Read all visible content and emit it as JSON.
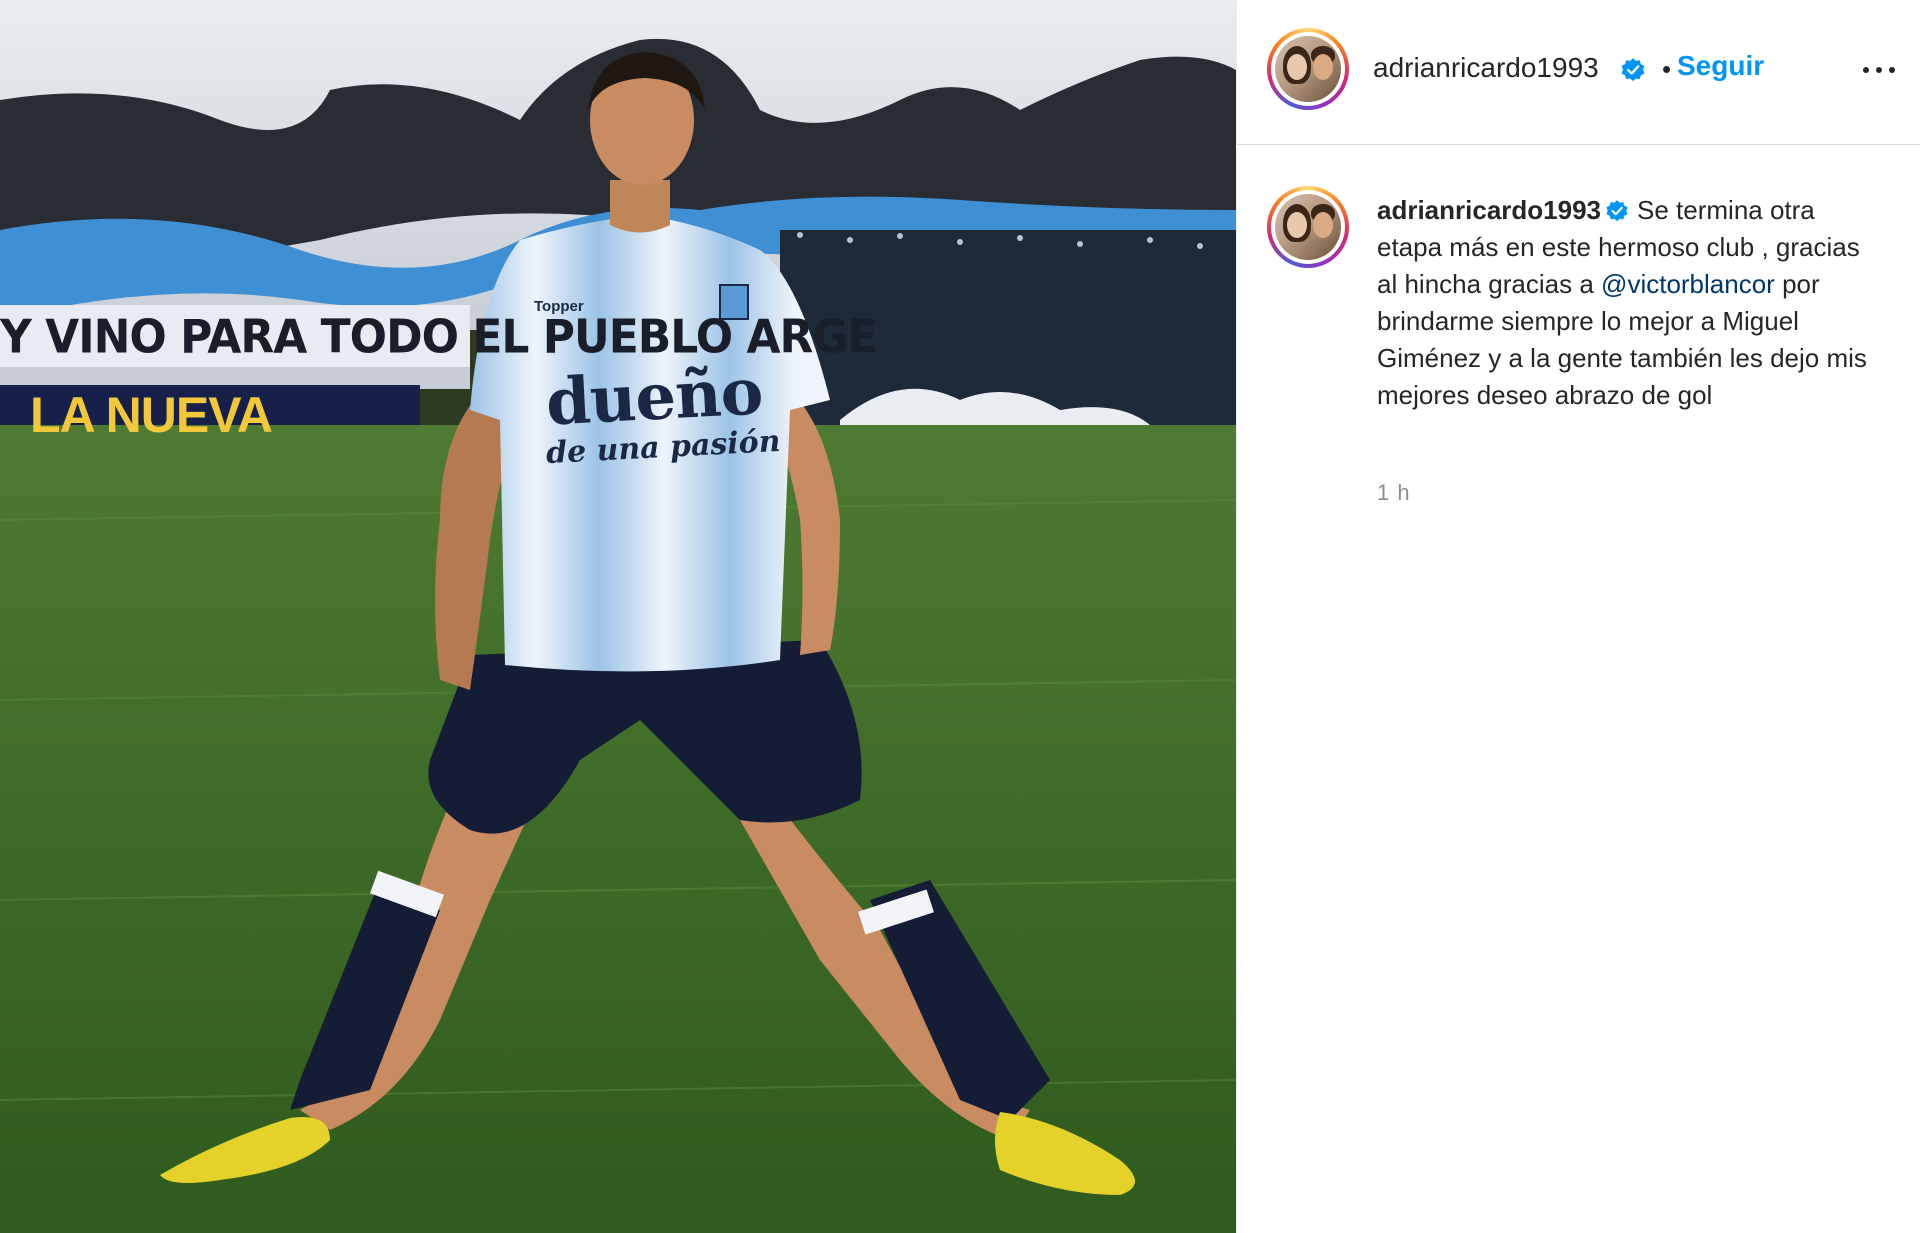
{
  "post": {
    "media": {
      "description_icon": "photo",
      "banner_text": "Y VINO PARA TODO EL PUEBLO ARGE",
      "ad_text": "LA NUEVA",
      "jersey_sponsor": "dueño",
      "jersey_sponsor_sub": "de una pasión",
      "jersey_brand": "Topper"
    },
    "header": {
      "username": "adrianricardo1993",
      "separator": "•",
      "follow_label": "Seguir",
      "more_icon": "more-horizontal-icon"
    },
    "caption": {
      "username": "adrianricardo1993",
      "text_part1": "Se termina otra etapa más en este hermoso club , gracias al hincha gracias a",
      "mention": "@victorblancor",
      "text_part2": "por brindarme siempre lo mejor a Miguel Giménez y a la gente también les dejo mis mejores deseo abrazo de gol",
      "timestamp": "1 h"
    },
    "colors": {
      "link": "#0095f6",
      "mention": "#00376b",
      "verified": "#0095f6",
      "muted": "#8e8e8e"
    }
  }
}
